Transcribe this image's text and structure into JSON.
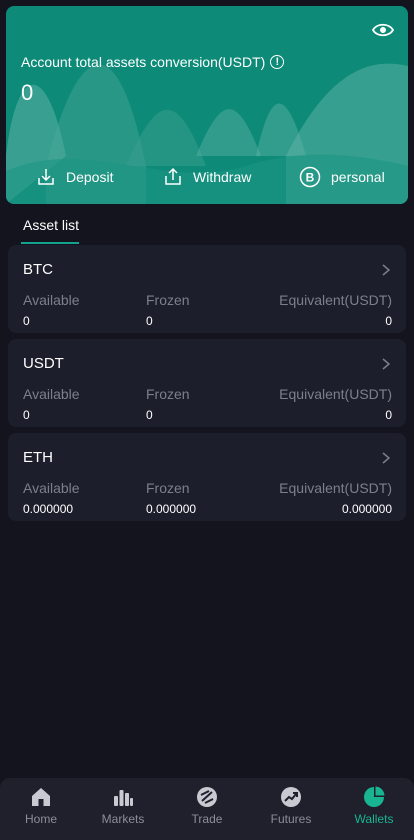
{
  "header": {
    "total_label": "Account total assets conversion(USDT)",
    "total_value": "0",
    "actions": [
      {
        "label": "Deposit",
        "icon": "download-icon"
      },
      {
        "label": "Withdraw",
        "icon": "upload-icon"
      },
      {
        "label": "personal",
        "icon": "bitcoin-icon"
      }
    ]
  },
  "tabs": {
    "asset_list": "Asset list"
  },
  "assets": [
    {
      "name": "BTC",
      "available_label": "Available",
      "frozen_label": "Frozen",
      "equivalent_label": "Equivalent(USDT)",
      "available": "0",
      "frozen": "0",
      "equivalent": "0"
    },
    {
      "name": "USDT",
      "available_label": "Available",
      "frozen_label": "Frozen",
      "equivalent_label": "Equivalent(USDT)",
      "available": "0",
      "frozen": "0",
      "equivalent": "0"
    },
    {
      "name": "ETH",
      "available_label": "Available",
      "frozen_label": "Frozen",
      "equivalent_label": "Equivalent(USDT)",
      "available": "0.000000",
      "frozen": "0.000000",
      "equivalent": "0.000000"
    }
  ],
  "nav": [
    {
      "label": "Home",
      "icon": "home-icon"
    },
    {
      "label": "Markets",
      "icon": "bar-chart-icon"
    },
    {
      "label": "Trade",
      "icon": "trade-icon"
    },
    {
      "label": "Futures",
      "icon": "trend-up-icon"
    },
    {
      "label": "Wallets",
      "icon": "pie-chart-icon",
      "active": true
    }
  ],
  "colors": {
    "accent": "#0d8a78",
    "active_nav": "#19b492",
    "background": "#13141d",
    "card": "#1d1e2b"
  }
}
